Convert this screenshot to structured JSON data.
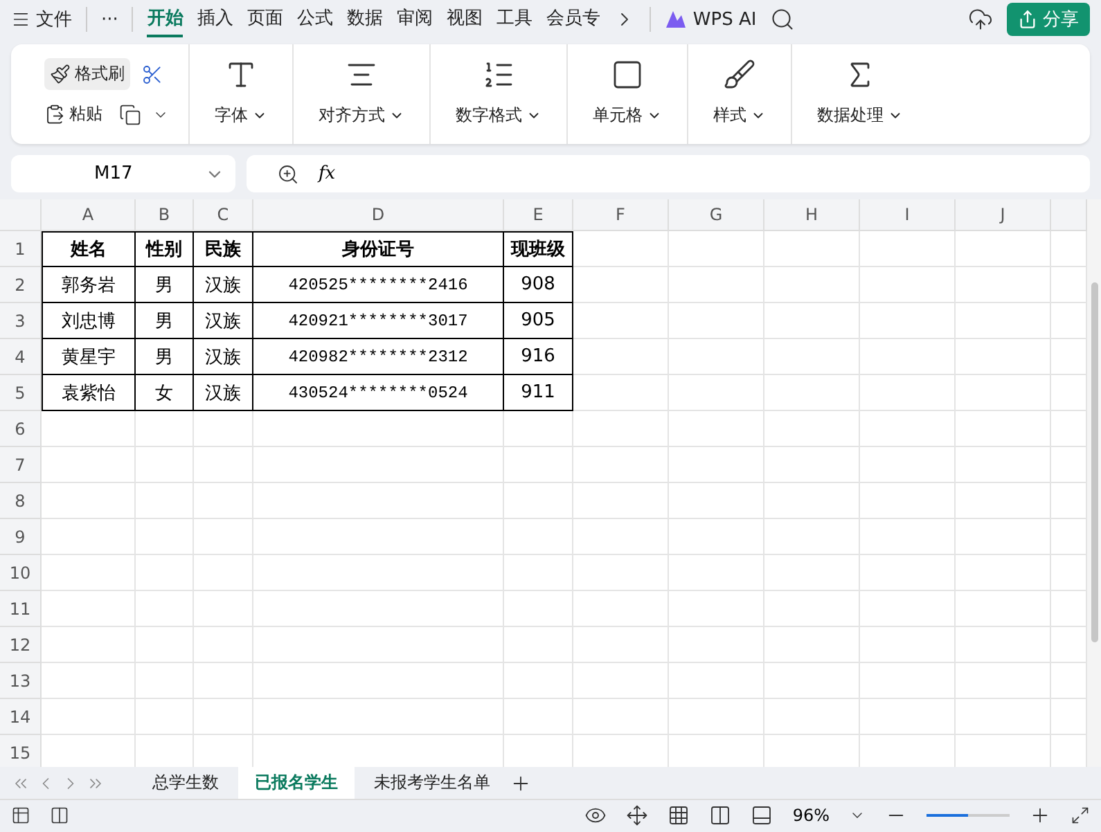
{
  "menu": {
    "file": "文件",
    "more": "···",
    "tabs": [
      {
        "label": "开始",
        "selected": true
      },
      {
        "label": "插入",
        "selected": false
      },
      {
        "label": "页面",
        "selected": false
      },
      {
        "label": "公式",
        "selected": false
      },
      {
        "label": "数据",
        "selected": false
      },
      {
        "label": "审阅",
        "selected": false
      },
      {
        "label": "视图",
        "selected": false
      },
      {
        "label": "工具",
        "selected": false
      },
      {
        "label": "会员专",
        "selected": false
      }
    ],
    "ai": "WPS AI",
    "share": "分享"
  },
  "ribbon": {
    "format_painter": "格式刷",
    "paste": "粘贴",
    "groups": [
      {
        "kind": "font",
        "label": "字体"
      },
      {
        "kind": "align",
        "label": "对齐方式"
      },
      {
        "kind": "number",
        "label": "数字格式"
      },
      {
        "kind": "cell",
        "label": "单元格"
      },
      {
        "kind": "style",
        "label": "样式"
      },
      {
        "kind": "sum",
        "label": "数据处理"
      }
    ]
  },
  "formula_bar": {
    "cell_ref": "M17",
    "fx": "fx"
  },
  "sheet": {
    "columns": [
      "A",
      "B",
      "C",
      "D",
      "E",
      "F",
      "G",
      "H",
      "I",
      "J"
    ],
    "row_numbers": [
      "1",
      "2",
      "3",
      "4",
      "5",
      "6",
      "7",
      "8",
      "9",
      "10",
      "11",
      "12",
      "13",
      "14",
      "15"
    ],
    "table": {
      "header": [
        "姓名",
        "性别",
        "民族",
        "身份证号",
        "现班级"
      ],
      "rows": [
        [
          "郭务岩",
          "男",
          "汉族",
          "420525********2416",
          "908"
        ],
        [
          "刘忠博",
          "男",
          "汉族",
          "420921********3017",
          "905"
        ],
        [
          "黄星宇",
          "男",
          "汉族",
          "420982********2312",
          "916"
        ],
        [
          "袁紫怡",
          "女",
          "汉族",
          "430524********0524",
          "911"
        ]
      ]
    }
  },
  "sheet_tabs": [
    {
      "label": "总学生数",
      "selected": false
    },
    {
      "label": "已报名学生",
      "selected": true
    },
    {
      "label": "未报考学生名单",
      "selected": false
    }
  ],
  "status_bar": {
    "zoom": "96%",
    "zoom_slider": {
      "level": 0.5
    }
  }
}
